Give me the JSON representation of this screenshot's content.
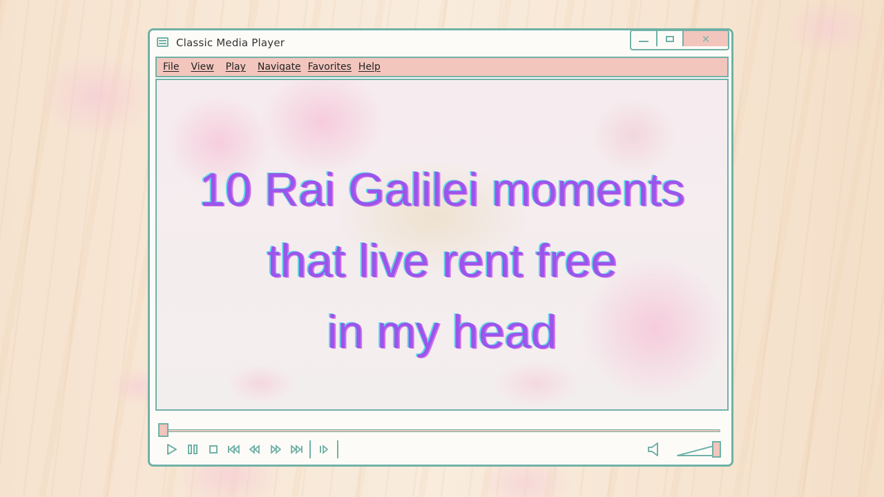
{
  "window": {
    "title": "Classic Media Player",
    "controls": {
      "minimize": "minimize",
      "maximize": "maximize",
      "close": "×"
    }
  },
  "menu": {
    "items": [
      "File",
      "View",
      "Play",
      "Navigate",
      "Favorites",
      "Help"
    ]
  },
  "video": {
    "caption_lines": [
      "10 Rai Galilei moments",
      "that live rent free",
      "in my head"
    ]
  },
  "playback": {
    "progress": 0,
    "volume": 1.0,
    "buttons": [
      "play-icon",
      "pause-icon",
      "stop-icon",
      "skip-back-icon",
      "rewind-icon",
      "fast-forward-icon",
      "skip-forward-icon",
      "frame-step-icon"
    ]
  },
  "colors": {
    "frame": "#6fb1a6",
    "menu_bg": "#f2c5bd",
    "caption": "#9b55ec"
  }
}
